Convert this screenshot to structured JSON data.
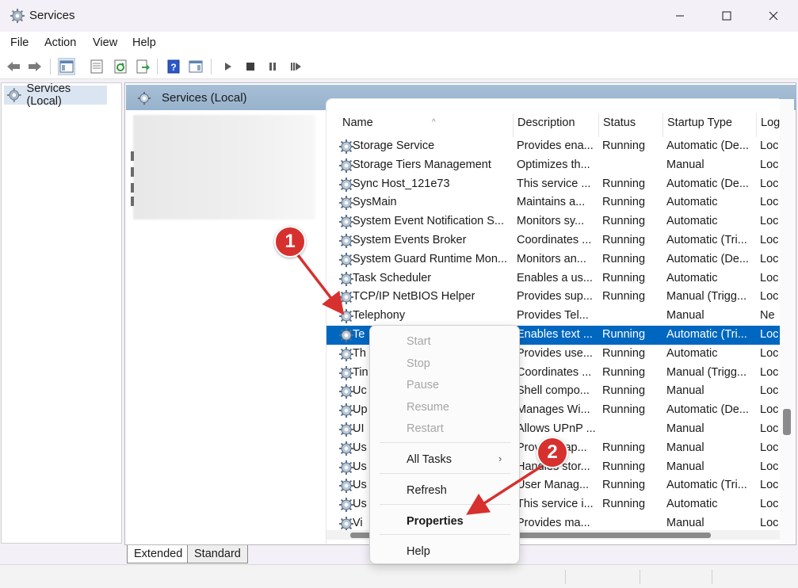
{
  "window": {
    "title": "Services",
    "icon": "gear-icon"
  },
  "menu": [
    "File",
    "Action",
    "View",
    "Help"
  ],
  "toolbar": {
    "icons": [
      "back-arrow-icon",
      "forward-arrow-icon",
      "show-hide-console-tree-icon",
      "properties-sheet-icon",
      "refresh-icon",
      "export-list-icon",
      "help-icon",
      "show-action-pane-icon",
      "play-icon",
      "stop-icon",
      "pause-icon",
      "restart-icon"
    ]
  },
  "tree": {
    "root_label": "Services (Local)"
  },
  "pane": {
    "title": "Services (Local)"
  },
  "columns": [
    "Name",
    "Description",
    "Status",
    "Startup Type",
    "Log"
  ],
  "rows": [
    [
      "Storage Service",
      "Provides ena...",
      "Running",
      "Automatic (De...",
      "Loc"
    ],
    [
      "Storage Tiers Management",
      "Optimizes th...",
      "",
      "Manual",
      "Loc"
    ],
    [
      "Sync Host_121e73",
      "This service ...",
      "Running",
      "Automatic (De...",
      "Loc"
    ],
    [
      "SysMain",
      "Maintains a...",
      "Running",
      "Automatic",
      "Loc"
    ],
    [
      "System Event Notification S...",
      "Monitors sy...",
      "Running",
      "Automatic",
      "Loc"
    ],
    [
      "System Events Broker",
      "Coordinates ...",
      "Running",
      "Automatic (Tri...",
      "Loc"
    ],
    [
      "System Guard Runtime Mon...",
      "Monitors an...",
      "Running",
      "Automatic (De...",
      "Loc"
    ],
    [
      "Task Scheduler",
      "Enables a us...",
      "Running",
      "Automatic",
      "Loc"
    ],
    [
      "TCP/IP NetBIOS Helper",
      "Provides sup...",
      "Running",
      "Manual (Trigg...",
      "Loc"
    ],
    [
      "Telephony",
      "Provides Tel...",
      "",
      "Manual",
      "Ne"
    ],
    [
      "Te",
      "Enables text ...",
      "Running",
      "Automatic (Tri...",
      "Loc"
    ],
    [
      "Th",
      "Provides use...",
      "Running",
      "Automatic",
      "Loc"
    ],
    [
      "Tin",
      "Coordinates ...",
      "Running",
      "Manual (Trigg...",
      "Loc"
    ],
    [
      "Uc",
      "Shell compo...",
      "Running",
      "Manual",
      "Loc"
    ],
    [
      "Up",
      "Manages Wi...",
      "Running",
      "Automatic (De...",
      "Loc"
    ],
    [
      "UI",
      "Allows UPnP ...",
      "",
      "Manual",
      "Loc"
    ],
    [
      "Us",
      "Provides ap...",
      "Running",
      "Manual",
      "Loc"
    ],
    [
      "Us",
      "Handles stor...",
      "Running",
      "Manual",
      "Loc"
    ],
    [
      "Us",
      "User Manag...",
      "Running",
      "Automatic (Tri...",
      "Loc"
    ],
    [
      "Us",
      "This service i...",
      "Running",
      "Automatic",
      "Loc"
    ],
    [
      "Vi",
      "Provides ma...",
      "",
      "Manual",
      "Loc"
    ]
  ],
  "selected_row_index": 10,
  "context_menu": {
    "items": [
      "Start",
      "Stop",
      "Pause",
      "Resume",
      "Restart",
      "All Tasks",
      "Refresh",
      "Properties",
      "Help"
    ],
    "disabled": [
      "Start",
      "Stop",
      "Pause",
      "Resume",
      "Restart"
    ],
    "bold": "Properties",
    "submenu_arrow": "›"
  },
  "tabs": [
    "Extended",
    "Standard"
  ],
  "annotations": {
    "badge1": "1",
    "badge2": "2",
    "color": "#d6312e"
  }
}
